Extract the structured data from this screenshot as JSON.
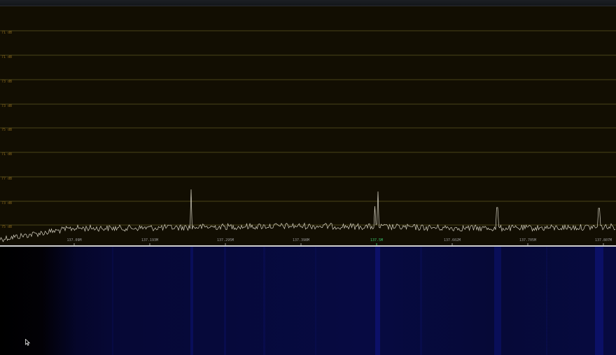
{
  "spectrum": {
    "db_labels": [
      "71 dB",
      "71 dB",
      "73 dB",
      "73 dB",
      "75 dB",
      "71 dB",
      "77 dB",
      "73 dB",
      "75 dB"
    ],
    "frequency_labels": [
      "137.09M",
      "137.193M",
      "137.295M",
      "137.398M",
      "137.5M",
      "137.602M",
      "137.705M",
      "137.807M"
    ],
    "center_frequency_label": "137.5M",
    "colors": {
      "background": "#120e02",
      "gridline": "#4a4418",
      "trace": "#d8d4c4",
      "center_label": "#3ac46a",
      "frequency_label": "#9a9a9a",
      "db_label": "#8a6a1e"
    }
  },
  "waterfall": {
    "colors": {
      "base": "#06093a",
      "dark": "#000000",
      "stripe": "#0c1166"
    }
  },
  "cursor": {
    "icon": "mouse-pointer-icon"
  }
}
